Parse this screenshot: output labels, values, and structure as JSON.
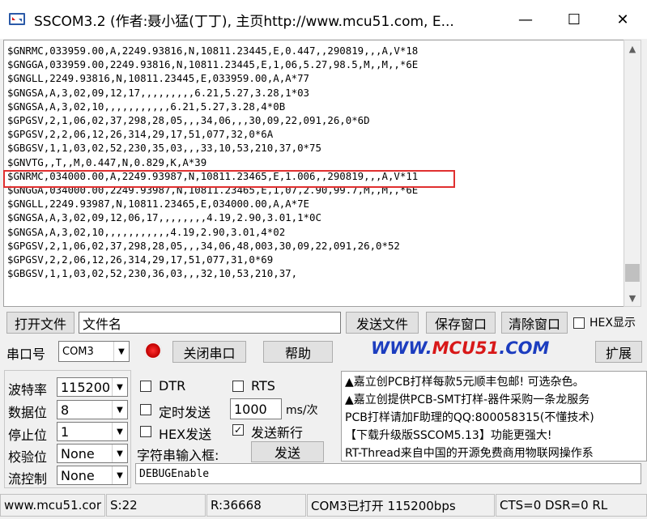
{
  "window": {
    "title": "SSCOM3.2 (作者:聂小猛(丁丁), 主页http://www.mcu51.com,  E...",
    "minimize_glyph": "—",
    "maximize_glyph": "☐",
    "close_glyph": "✕"
  },
  "receive": {
    "lines": [
      "$GNRMC,033959.00,A,2249.93816,N,10811.23445,E,0.447,,290819,,,A,V*18",
      "$GNGGA,033959.00,2249.93816,N,10811.23445,E,1,06,5.27,98.5,M,,M,,*6E",
      "$GNGLL,2249.93816,N,10811.23445,E,033959.00,A,A*77",
      "$GNGSA,A,3,02,09,12,17,,,,,,,,,6.21,5.27,3.28,1*03",
      "$GNGSA,A,3,02,10,,,,,,,,,,,6.21,5.27,3.28,4*0B",
      "$GPGSV,2,1,06,02,37,298,28,05,,,34,06,,,30,09,22,091,26,0*6D",
      "$GPGSV,2,2,06,12,26,314,29,17,51,077,32,0*6A",
      "$GBGSV,1,1,03,02,52,230,35,03,,,33,10,53,210,37,0*75",
      "$GNVTG,,T,,M,0.447,N,0.829,K,A*39",
      "$GNRMC,034000.00,A,2249.93987,N,10811.23465,E,1.006,,290819,,,A,V*11",
      "$GNGGA,034000.00,2249.93987,N,10811.23465,E,1,07,2.90,99.7,M,,M,,*6E",
      "$GNGLL,2249.93987,N,10811.23465,E,034000.00,A,A*7E",
      "$GNGSA,A,3,02,09,12,06,17,,,,,,,,4.19,2.90,3.01,1*0C",
      "$GNGSA,A,3,02,10,,,,,,,,,,,4.19,2.90,3.01,4*02",
      "$GPGSV,2,1,06,02,37,298,28,05,,,34,06,48,003,30,09,22,091,26,0*52",
      "$GPGSV,2,2,06,12,26,314,29,17,51,077,31,0*69",
      "$GBGSV,1,1,03,02,52,230,36,03,,,32,10,53,210,37,"
    ]
  },
  "toolbar": {
    "open_file": "打开文件",
    "filename": "文件名",
    "send_file": "发送文件",
    "save_window": "保存窗口",
    "clear_window": "清除窗口",
    "hex_display": "HEX显示"
  },
  "port": {
    "label": "串口号",
    "value": "COM3",
    "close_port": "关闭串口",
    "help": "帮助",
    "expand": "扩展"
  },
  "logo": {
    "part1": "WWW.",
    "part2": "MCU51",
    "part3": ".COM"
  },
  "settings": {
    "baud_label": "波特率",
    "baud_value": "115200",
    "databits_label": "数据位",
    "databits_value": "8",
    "stopbits_label": "停止位",
    "stopbits_value": "1",
    "parity_label": "校验位",
    "parity_value": "None",
    "flow_label": "流控制",
    "flow_value": "None"
  },
  "options": {
    "dtr": "DTR",
    "rts": "RTS",
    "timed_send": "定时发送",
    "interval_value": "1000",
    "interval_unit": "ms/次",
    "hex_send": "HEX发送",
    "send_newline": "发送新行",
    "input_label": "字符串输入框:",
    "send_button": "发送"
  },
  "info": {
    "lines": [
      "▲嘉立创PCB打样每款5元顺丰包邮! 可选杂色。",
      "▲嘉立创提供PCB-SMT打样-器件采购一条龙服务",
      "PCB打样请加F助理的QQ:800058315(不懂技术)",
      "【下载升级版SSCOM5.13】功能更强大!",
      "RT-Thread来自中国的开源免费商用物联网操作系"
    ]
  },
  "command": {
    "value": "DEBUGEnable"
  },
  "status": {
    "site": "www.mcu51.cor",
    "sent": "S:22",
    "received": "R:36668",
    "port_state": "COM3已打开  115200bps",
    "lines": "CTS=0 DSR=0 RL"
  }
}
